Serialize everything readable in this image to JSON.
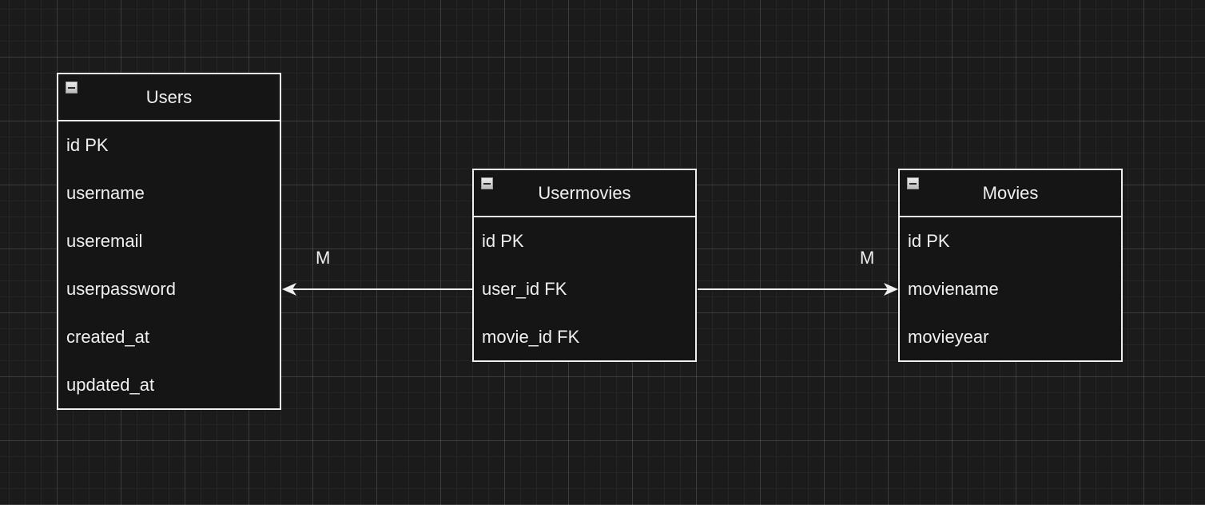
{
  "entities": {
    "users": {
      "title": "Users",
      "fields": [
        "id PK",
        "username",
        "useremail",
        "userpassword",
        "created_at",
        "updated_at"
      ]
    },
    "usermovies": {
      "title": "Usermovies",
      "fields": [
        "id PK",
        "user_id FK",
        "movie_id FK"
      ]
    },
    "movies": {
      "title": "Movies",
      "fields": [
        "id PK",
        "moviename",
        "movieyear"
      ]
    }
  },
  "relations": {
    "left_label": "M",
    "right_label": "M"
  },
  "colors": {
    "background": "#1b1b1b",
    "stroke": "#f0f0f0",
    "text": "#f0f0f0"
  }
}
